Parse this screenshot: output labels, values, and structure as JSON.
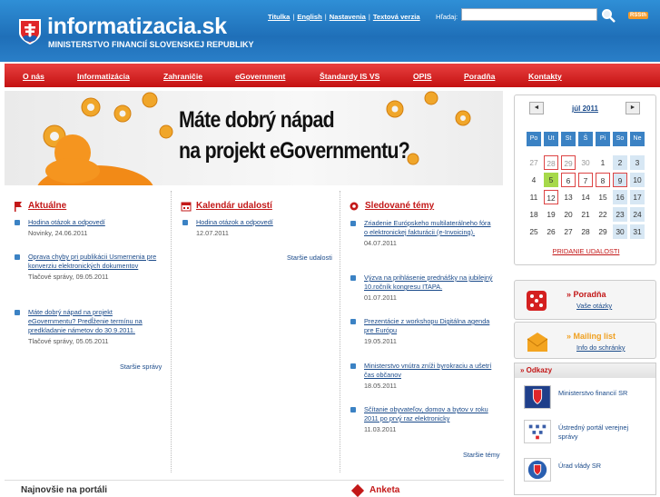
{
  "header": {
    "logo_title": "informatizacia.sk",
    "logo_subtitle": "MINISTERSTVO FINANCIÍ SLOVENSKEJ REPUBLIKY",
    "top_links": [
      "Titulka",
      "English",
      "Nastavenia",
      "Textová verzia"
    ],
    "search_label": "Hľadaj:",
    "search_value": "",
    "rss_label": "RSSth"
  },
  "nav": [
    "O nás",
    "Informatizácia",
    "Zahraničie",
    "eGovernment",
    "Štandardy IS VS",
    "OPIS",
    "Poradňa",
    "Kontakty"
  ],
  "banner": {
    "line1": "Máte dobrý nápad",
    "line2": "na projekt eGovernmentu?"
  },
  "aktualne": {
    "heading": "Aktuálne",
    "items": [
      {
        "title": "Hodina otázok a odpovedí",
        "meta": "Novinky, 24.06.2011"
      },
      {
        "title": "Oprava chyby pri publikácii Usmernenia pre konverziu elektronických dokumentov",
        "meta": "Tlačové správy, 09.05.2011"
      },
      {
        "title": "Máte dobrý nápad na projekt eGovernmentu? Predĺženie termínu na predkladanie námetov do 30.9.2011.",
        "meta": "Tlačové správy, 05.05.2011"
      }
    ],
    "more": "Staršie správy"
  },
  "kalendar": {
    "heading": "Kalendár udalostí",
    "items": [
      {
        "title": "Hodina otázok a odpovedí",
        "meta": "12.07.2011"
      }
    ],
    "more": "Staršie udalosti"
  },
  "sledovane": {
    "heading": "Sledované témy",
    "items": [
      {
        "title": "Zriadenie Európskeho multilaterálneho fóra o elektronickej fakturácii (e-Invoicing).",
        "meta": "04.07.2011"
      },
      {
        "title": "Výzva na prihlásenie prednášky na jubilejný 10.ročník kongresu ITAPA.",
        "meta": "01.07.2011"
      },
      {
        "title": "Prezentácie z workshopu Digitálna agenda pre Európu",
        "meta": "19.05.2011"
      },
      {
        "title": "Ministerstvo vnútra zníži byrokraciu a ušetrí čas občanov",
        "meta": "18.05.2011"
      },
      {
        "title": "Sčítanie obyvateľov, domov a bytov v roku 2011 po prvý raz elektronicky",
        "meta": "11.03.2011"
      }
    ],
    "more": "Staršie témy"
  },
  "calendar": {
    "month": "júl 2011",
    "prev": "◄",
    "next": "►",
    "dow": [
      "Po",
      "Ut",
      "St",
      "Š",
      "Pi",
      "So",
      "Ne"
    ],
    "weeks": [
      [
        "27",
        "28",
        "29",
        "30",
        "1",
        "2",
        "3"
      ],
      [
        "4",
        "5",
        "6",
        "7",
        "8",
        "9",
        "10"
      ],
      [
        "11",
        "12",
        "13",
        "14",
        "15",
        "16",
        "17"
      ],
      [
        "18",
        "19",
        "20",
        "21",
        "22",
        "23",
        "24"
      ],
      [
        "25",
        "26",
        "27",
        "28",
        "29",
        "30",
        "31"
      ]
    ],
    "add_label": "PRIDANIE UDALOSTI"
  },
  "poradna": {
    "title": "» Poradňa",
    "sub": "Vaše otázky"
  },
  "mailing": {
    "title": "» Mailing list",
    "sub": "Info do schránky"
  },
  "odkazy": {
    "heading": "» Odkazy",
    "links": [
      "Ministerstvo financií SR",
      "Ústredný portál verejnej správy",
      "Úrad vlády SR"
    ]
  },
  "bottom": {
    "najnovsie": "Najnovšie na portáli",
    "anketa": "Anketa"
  },
  "colors": {
    "brand_red": "#c31818",
    "brand_blue": "#1f6fb8",
    "link": "#1a4a8a"
  }
}
